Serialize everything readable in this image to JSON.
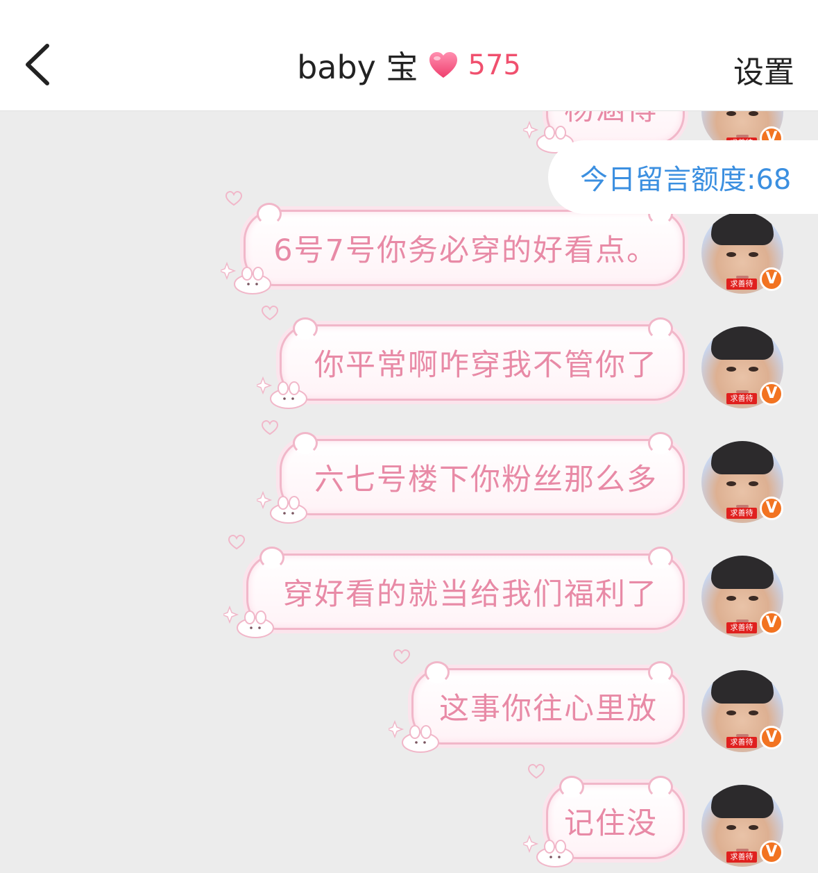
{
  "header": {
    "title": "baby 宝",
    "intimacy": "575",
    "settings_label": "设置"
  },
  "quota": {
    "label": "今日留言额度:68"
  },
  "colors": {
    "bubble_text": "#e88aa6",
    "bubble_border": "#f1b7c9",
    "heart_count": "#f0506e",
    "quota_text": "#3b8fe0",
    "verified_badge": "#f27321"
  },
  "avatar": {
    "tag": "求善待",
    "badge": "V"
  },
  "messages": [
    {
      "text": "杨涵博"
    },
    {
      "text": "6号7号你务必穿的好看点。"
    },
    {
      "text": "你平常啊咋穿我不管你了"
    },
    {
      "text": "六七号楼下你粉丝那么多"
    },
    {
      "text": "穿好看的就当给我们福利了"
    },
    {
      "text": "这事你往心里放"
    },
    {
      "text": "记住没"
    }
  ]
}
